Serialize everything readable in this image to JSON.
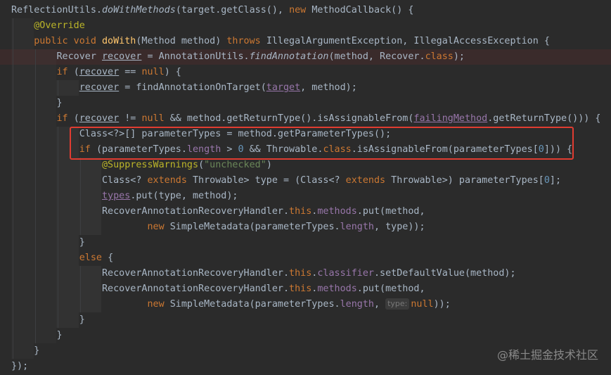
{
  "code": {
    "lines": [
      [
        {
          "t": "ReflectionUtils."
        },
        {
          "t": "doWithMethods",
          "c": "it"
        },
        {
          "t": "(target.getClass(), "
        },
        {
          "t": "new ",
          "c": "kw"
        },
        {
          "t": "MethodCallback() {"
        }
      ],
      [
        {
          "t": "    "
        },
        {
          "t": "@Override",
          "c": "an"
        }
      ],
      [
        {
          "t": "    "
        },
        {
          "t": "public void ",
          "c": "kw"
        },
        {
          "t": "doWith",
          "c": "fn"
        },
        {
          "t": "(Method method) "
        },
        {
          "t": "throws ",
          "c": "kw"
        },
        {
          "t": "IllegalArgumentException, IllegalAccessException {"
        }
      ],
      [
        {
          "t": "        Recover "
        },
        {
          "t": "recover",
          "c": "ul"
        },
        {
          "t": " = AnnotationUtils."
        },
        {
          "t": "findAnnotation",
          "c": "it"
        },
        {
          "t": "(method, Recover."
        },
        {
          "t": "class",
          "c": "kw"
        },
        {
          "t": ");"
        }
      ],
      [
        {
          "t": "        "
        },
        {
          "t": "if ",
          "c": "kw"
        },
        {
          "t": "("
        },
        {
          "t": "recover",
          "c": "ul"
        },
        {
          "t": " == "
        },
        {
          "t": "null",
          "c": "kw"
        },
        {
          "t": ") {"
        }
      ],
      [
        {
          "t": "            "
        },
        {
          "t": "recover",
          "c": "ul"
        },
        {
          "t": " = findAnnotationOnTarget("
        },
        {
          "t": "target",
          "c": "fld ulp"
        },
        {
          "t": ", method);"
        }
      ],
      [
        {
          "t": "        }"
        }
      ],
      [
        {
          "t": "        "
        },
        {
          "t": "if ",
          "c": "kw"
        },
        {
          "t": "("
        },
        {
          "t": "recover",
          "c": "ul"
        },
        {
          "t": " != "
        },
        {
          "t": "null ",
          "c": "kw"
        },
        {
          "t": "&& method.getReturnType().isAssignableFrom("
        },
        {
          "t": "failingMethod",
          "c": "fld ulp"
        },
        {
          "t": ".getReturnType())) {"
        }
      ],
      [
        {
          "t": "            Class<?>[] parameterTypes = method.getParameterTypes();"
        }
      ],
      [
        {
          "t": "            "
        },
        {
          "t": "if ",
          "c": "kw"
        },
        {
          "t": "(parameterTypes."
        },
        {
          "t": "length",
          "c": "fld"
        },
        {
          "t": " > "
        },
        {
          "t": "0",
          "c": "num"
        },
        {
          "t": " && Throwable."
        },
        {
          "t": "class",
          "c": "kw"
        },
        {
          "t": ".isAssignableFrom(parameterTypes["
        },
        {
          "t": "0",
          "c": "num"
        },
        {
          "t": "])) {"
        }
      ],
      [
        {
          "t": "                "
        },
        {
          "t": "@SuppressWarnings",
          "c": "an"
        },
        {
          "t": "("
        },
        {
          "t": "\"unchecked\"",
          "c": "str"
        },
        {
          "t": ")"
        }
      ],
      [
        {
          "t": "                Class<? "
        },
        {
          "t": "extends ",
          "c": "kw"
        },
        {
          "t": "Throwable> type = (Class<? "
        },
        {
          "t": "extends ",
          "c": "kw"
        },
        {
          "t": "Throwable>) parameterTypes["
        },
        {
          "t": "0",
          "c": "num"
        },
        {
          "t": "];"
        }
      ],
      [
        {
          "t": "                "
        },
        {
          "t": "types",
          "c": "fld ulp"
        },
        {
          "t": ".put(type, method);"
        }
      ],
      [
        {
          "t": "                RecoverAnnotationRecoveryHandler."
        },
        {
          "t": "this",
          "c": "kw"
        },
        {
          "t": "."
        },
        {
          "t": "methods",
          "c": "fld"
        },
        {
          "t": ".put(method,"
        }
      ],
      [
        {
          "t": "                        "
        },
        {
          "t": "new ",
          "c": "kw"
        },
        {
          "t": "SimpleMetadata(parameterTypes."
        },
        {
          "t": "length",
          "c": "fld"
        },
        {
          "t": ", type));"
        }
      ],
      [
        {
          "t": "            }"
        }
      ],
      [
        {
          "t": "            "
        },
        {
          "t": "else ",
          "c": "kw"
        },
        {
          "t": "{"
        }
      ],
      [
        {
          "t": "                RecoverAnnotationRecoveryHandler."
        },
        {
          "t": "this",
          "c": "kw"
        },
        {
          "t": "."
        },
        {
          "t": "classifier",
          "c": "fld"
        },
        {
          "t": ".setDefaultValue(method);"
        }
      ],
      [
        {
          "t": "                RecoverAnnotationRecoveryHandler."
        },
        {
          "t": "this",
          "c": "kw"
        },
        {
          "t": "."
        },
        {
          "t": "methods",
          "c": "fld"
        },
        {
          "t": ".put(method,"
        }
      ],
      [
        {
          "t": "                        "
        },
        {
          "t": "new ",
          "c": "kw"
        },
        {
          "t": "SimpleMetadata(parameterTypes."
        },
        {
          "t": "length",
          "c": "fld"
        },
        {
          "t": ", "
        },
        {
          "t": "type:",
          "c": "hint"
        },
        {
          "t": "null",
          "c": "kw"
        },
        {
          "t": "));"
        }
      ],
      [
        {
          "t": "            }"
        }
      ],
      [
        {
          "t": "        }"
        }
      ],
      [
        {
          "t": "    }"
        }
      ],
      [
        {
          "t": "});"
        }
      ]
    ]
  },
  "watermark": "@稀土掘金技术社区",
  "colors": {
    "background": "#2b2b2b",
    "default_text": "#a9b7c6",
    "keyword": "#cc7832",
    "annotation": "#bbb529",
    "method_declaration": "#ffc66d",
    "field": "#9876aa",
    "number": "#6897bb",
    "string": "#6a8759",
    "highlight_box": "#e03c31"
  }
}
